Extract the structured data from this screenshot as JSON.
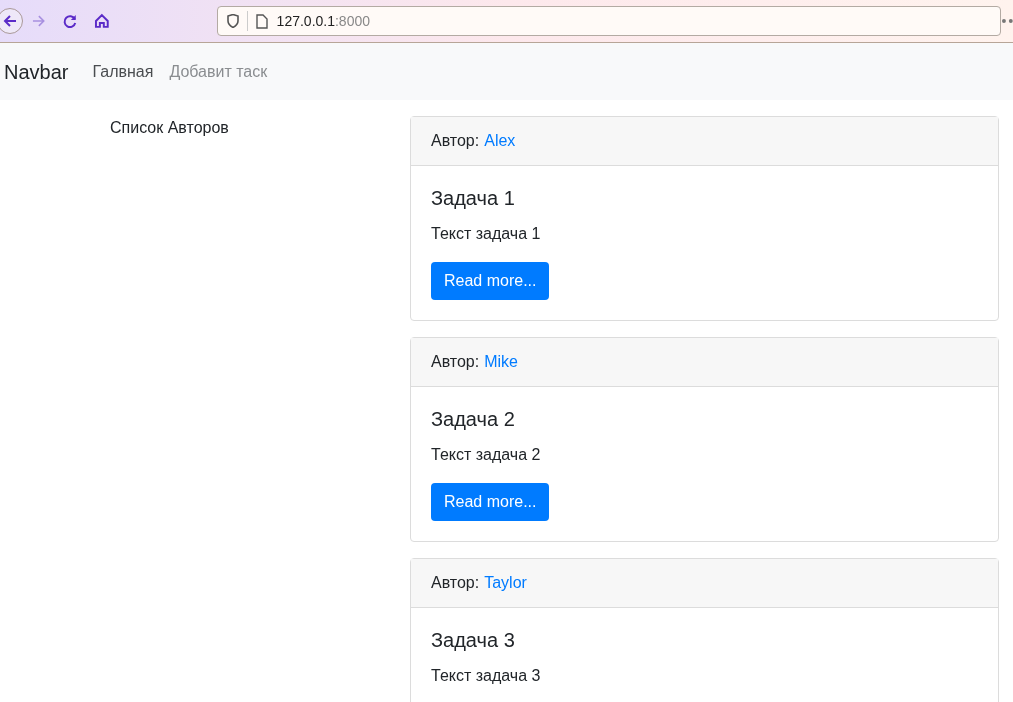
{
  "browser": {
    "url_host": "127.0.0.1",
    "url_port": ":8000"
  },
  "navbar": {
    "brand": "Navbar",
    "links": [
      {
        "label": "Галвная",
        "selected": true
      },
      {
        "label": "Добавит таск",
        "selected": false
      }
    ]
  },
  "sidebar": {
    "title": "Список Авторов"
  },
  "tasks": [
    {
      "author_label": "Автор:",
      "author": "Alex",
      "title": "Задача 1",
      "text": "Текст задача 1",
      "button": "Read more..."
    },
    {
      "author_label": "Автор:",
      "author": "Mike",
      "title": "Задача 2",
      "text": "Текст задача 2",
      "button": "Read more..."
    },
    {
      "author_label": "Автор:",
      "author": "Taylor",
      "title": "Задача 3",
      "text": "Текст задача 3"
    }
  ]
}
